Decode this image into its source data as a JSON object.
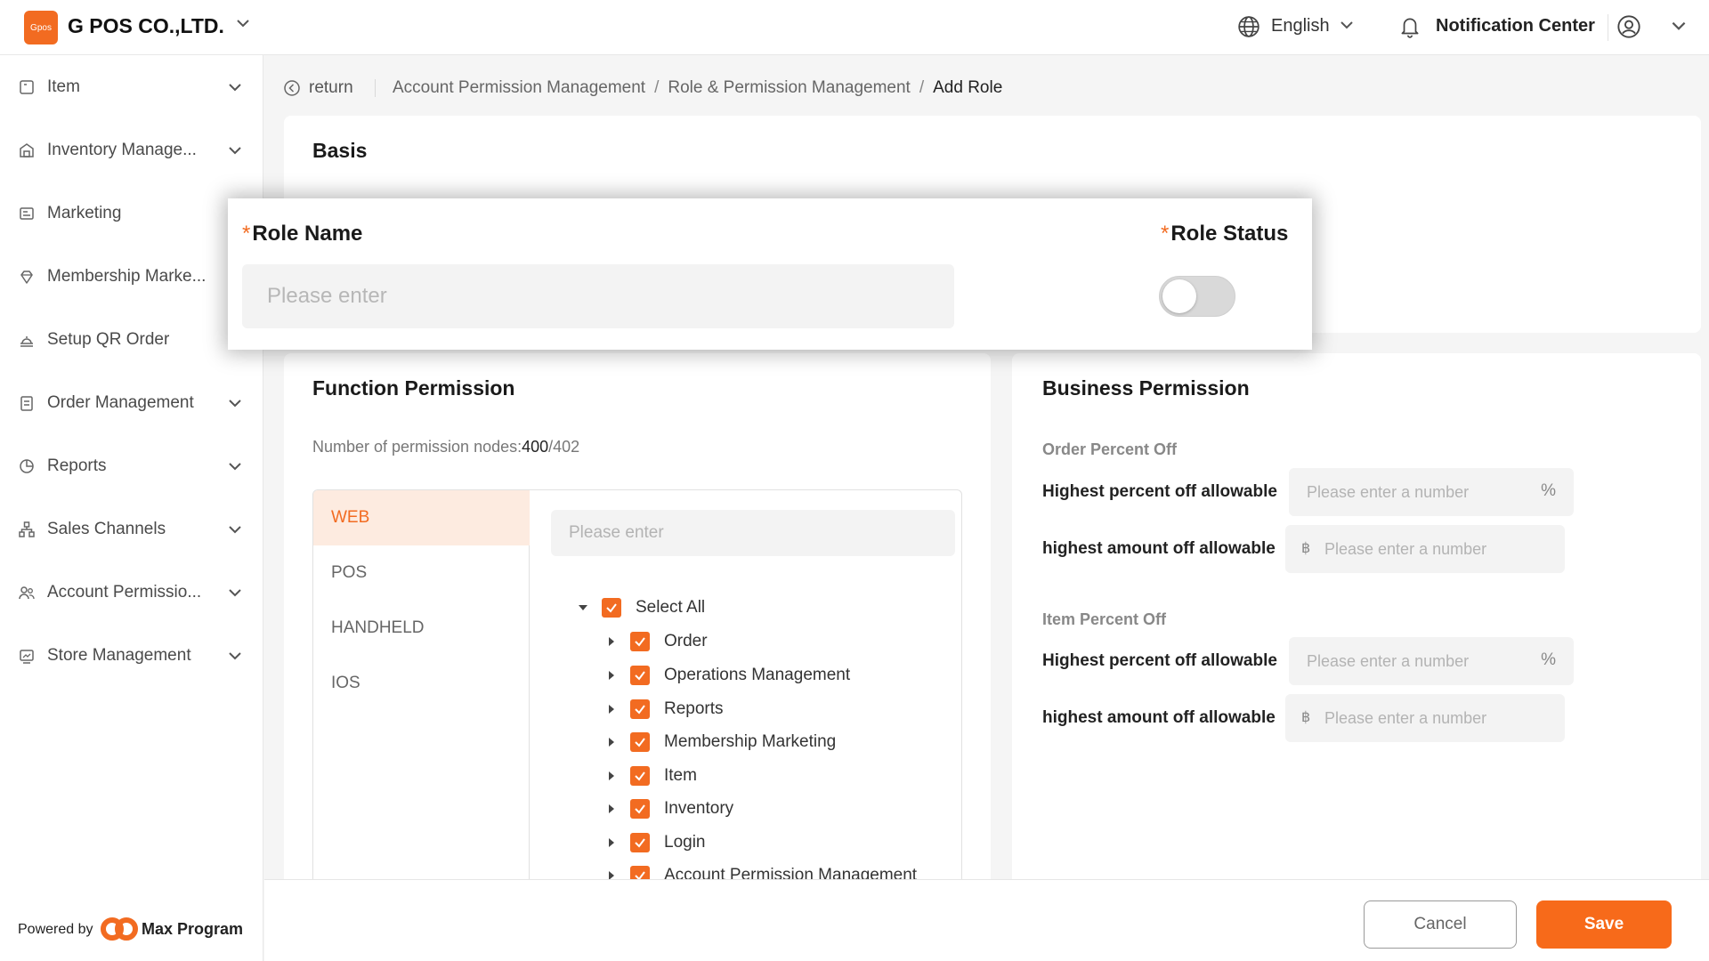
{
  "header": {
    "logo_text": "Gpos",
    "company": "G POS CO.,LTD.",
    "language": "English",
    "notification_center": "Notification Center"
  },
  "sidebar": {
    "items": [
      {
        "label": "Item",
        "icon": "item-icon",
        "has_caret": true
      },
      {
        "label": "Inventory Manage...",
        "icon": "inventory-icon",
        "has_caret": true
      },
      {
        "label": "Marketing",
        "icon": "marketing-icon",
        "has_caret": false
      },
      {
        "label": "Membership Marke...",
        "icon": "membership-icon",
        "has_caret": false
      },
      {
        "label": "Setup QR Order",
        "icon": "qr-order-icon",
        "has_caret": false
      },
      {
        "label": "Order Management",
        "icon": "order-icon",
        "has_caret": true
      },
      {
        "label": "Reports",
        "icon": "reports-icon",
        "has_caret": true
      },
      {
        "label": "Sales Channels",
        "icon": "sales-channels-icon",
        "has_caret": true
      },
      {
        "label": "Account Permissio...",
        "icon": "account-icon",
        "has_caret": true
      },
      {
        "label": "Store Management",
        "icon": "store-icon",
        "has_caret": true
      }
    ],
    "powered_by": "Powered by",
    "brand": "Max Program"
  },
  "breadcrumb": {
    "return": "return",
    "items": [
      "Account Permission Management",
      "Role & Permission Management"
    ],
    "current": "Add Role"
  },
  "basis": {
    "title": "Basis",
    "role_name_label": "Role Name",
    "role_name_placeholder": "Please enter",
    "role_status_label": "Role Status",
    "required_mark": "*",
    "role_status_on": false
  },
  "function_permission": {
    "title": "Function Permission",
    "nodes_label": "Number of permission nodes:",
    "nodes_selected": "400",
    "nodes_total": "/402",
    "platforms": [
      "WEB",
      "POS",
      "HANDHELD",
      "IOS"
    ],
    "active_platform": "WEB",
    "search_placeholder": "Please enter",
    "select_all": "Select All",
    "tree": [
      "Order",
      "Operations Management",
      "Reports",
      "Membership Marketing",
      "Item",
      "Inventory",
      "Login",
      "Account Permission Management"
    ]
  },
  "business_permission": {
    "title": "Business Permission",
    "order_section": "Order Percent Off",
    "item_section": "Item Percent Off",
    "highest_percent_label": "Highest percent off allowable",
    "highest_amount_label": "highest amount off allowable",
    "number_placeholder": "Please enter a number",
    "percent_suffix": "%",
    "currency_prefix": "฿"
  },
  "footer": {
    "cancel": "Cancel",
    "save": "Save"
  },
  "colors": {
    "accent": "#f26b21",
    "save_button": "#f76a1a",
    "active_tab_bg": "#fdebe0"
  }
}
